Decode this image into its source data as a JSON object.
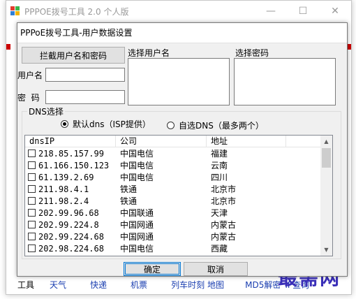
{
  "main_window": {
    "title": "PPPOE拨号工具 2.0 个人版",
    "controls": [
      "—",
      "☐",
      "✕"
    ],
    "bottom_bar": [
      "工具",
      "天气",
      "快递",
      "机票",
      "列车时刻",
      "地图",
      "MD5解密",
      "IP查询"
    ],
    "watermark": "最需网"
  },
  "dialog": {
    "title": "PPPoE拨号工具-用户数据设置",
    "intercept_button": "拦截用户名和密码",
    "username_label": "用户名",
    "username_value": "",
    "password_label": "密  码",
    "password_value": "",
    "select_user_label": "选择用户名",
    "select_password_label": "选择密码",
    "dns_group_label": "DNS选择",
    "radio_default": "默认dns（ISP提供）",
    "radio_custom": "自选DNS（最多两个）",
    "radio_default_selected": true,
    "ok_button": "确定",
    "cancel_button": "取消"
  },
  "dns_table": {
    "columns": [
      "dnsIP",
      "公司",
      "地址",
      ""
    ],
    "rows": [
      {
        "ip": "218.85.157.99",
        "company": "中国电信",
        "location": "福建"
      },
      {
        "ip": "61.166.150.123",
        "company": "中国电信",
        "location": "云南"
      },
      {
        "ip": "61.139.2.69",
        "company": "中国电信",
        "location": "四川"
      },
      {
        "ip": "211.98.4.1",
        "company": "铁通",
        "location": "北京市"
      },
      {
        "ip": "211.98.2.4",
        "company": "铁通",
        "location": "北京市"
      },
      {
        "ip": "202.99.96.68",
        "company": "中国联通",
        "location": "天津"
      },
      {
        "ip": "202.99.224.8",
        "company": "中国网通",
        "location": "内蒙古"
      },
      {
        "ip": "202.99.224.68",
        "company": "中国网通",
        "location": "内蒙古"
      },
      {
        "ip": "202.98.224.68",
        "company": "中国电信",
        "location": "西藏"
      }
    ]
  },
  "colors": {
    "accent": "#0078d7",
    "link": "#1a3eb0",
    "watermark": "#3a2fb8",
    "red_marker": "#cc0000"
  }
}
